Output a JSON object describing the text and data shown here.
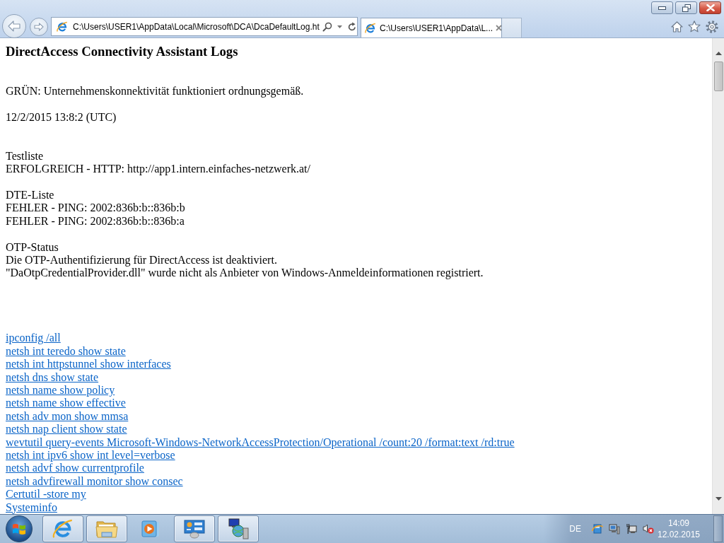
{
  "address_bar": {
    "url": "C:\\Users\\USER1\\AppData\\Local\\Microsoft\\DCA\\DcaDefaultLog.ht"
  },
  "tabs": [
    {
      "label": "C:\\Users\\USER1\\AppData\\L...",
      "selected": true
    }
  ],
  "page": {
    "title": "DirectAccess Connectivity Assistant Logs",
    "status": "GRÜN: Unternehmenskonnektivität funktioniert ordnungsgemäß.",
    "timestamp": "12/2/2015 13:8:2 (UTC)",
    "sections": [
      {
        "heading": "Testliste",
        "lines": [
          "ERFOLGREICH - HTTP: http://app1.intern.einfaches-netzwerk.at/"
        ]
      },
      {
        "heading": "DTE-Liste",
        "lines": [
          "FEHLER - PING: 2002:836b:b::836b:b",
          "FEHLER - PING: 2002:836b:b::836b:a"
        ]
      },
      {
        "heading": "OTP-Status",
        "lines": [
          "Die OTP-Authentifizierung für DirectAccess ist deaktiviert.",
          "\"DaOtpCredentialProvider.dll\" wurde nicht als Anbieter von Windows-Anmeldeinformationen registriert."
        ]
      }
    ],
    "links": [
      "ipconfig /all",
      "netsh int teredo show state",
      "netsh int httpstunnel show interfaces",
      "netsh dns show state",
      "netsh name show policy",
      "netsh name show effective",
      "netsh adv mon show mmsa",
      "netsh nap client show state",
      "wevtutil query-events Microsoft-Windows-NetworkAccessProtection/Operational /count:20 /format:text /rd:true",
      "netsh int ipv6 show int level=verbose",
      "netsh advf show currentprofile",
      "netsh advfirewall monitor show consec",
      "Certutil -store my",
      "Systeminfo"
    ]
  },
  "taskbar": {
    "apps": [
      {
        "kind": "browser",
        "running": true
      },
      {
        "kind": "folder",
        "running": true
      },
      {
        "kind": "media",
        "running": false
      },
      {
        "kind": "panel",
        "running": true
      },
      {
        "kind": "network",
        "running": true
      }
    ],
    "language": "DE",
    "clock": {
      "time": "14:09",
      "date": "12.02.2015"
    }
  }
}
